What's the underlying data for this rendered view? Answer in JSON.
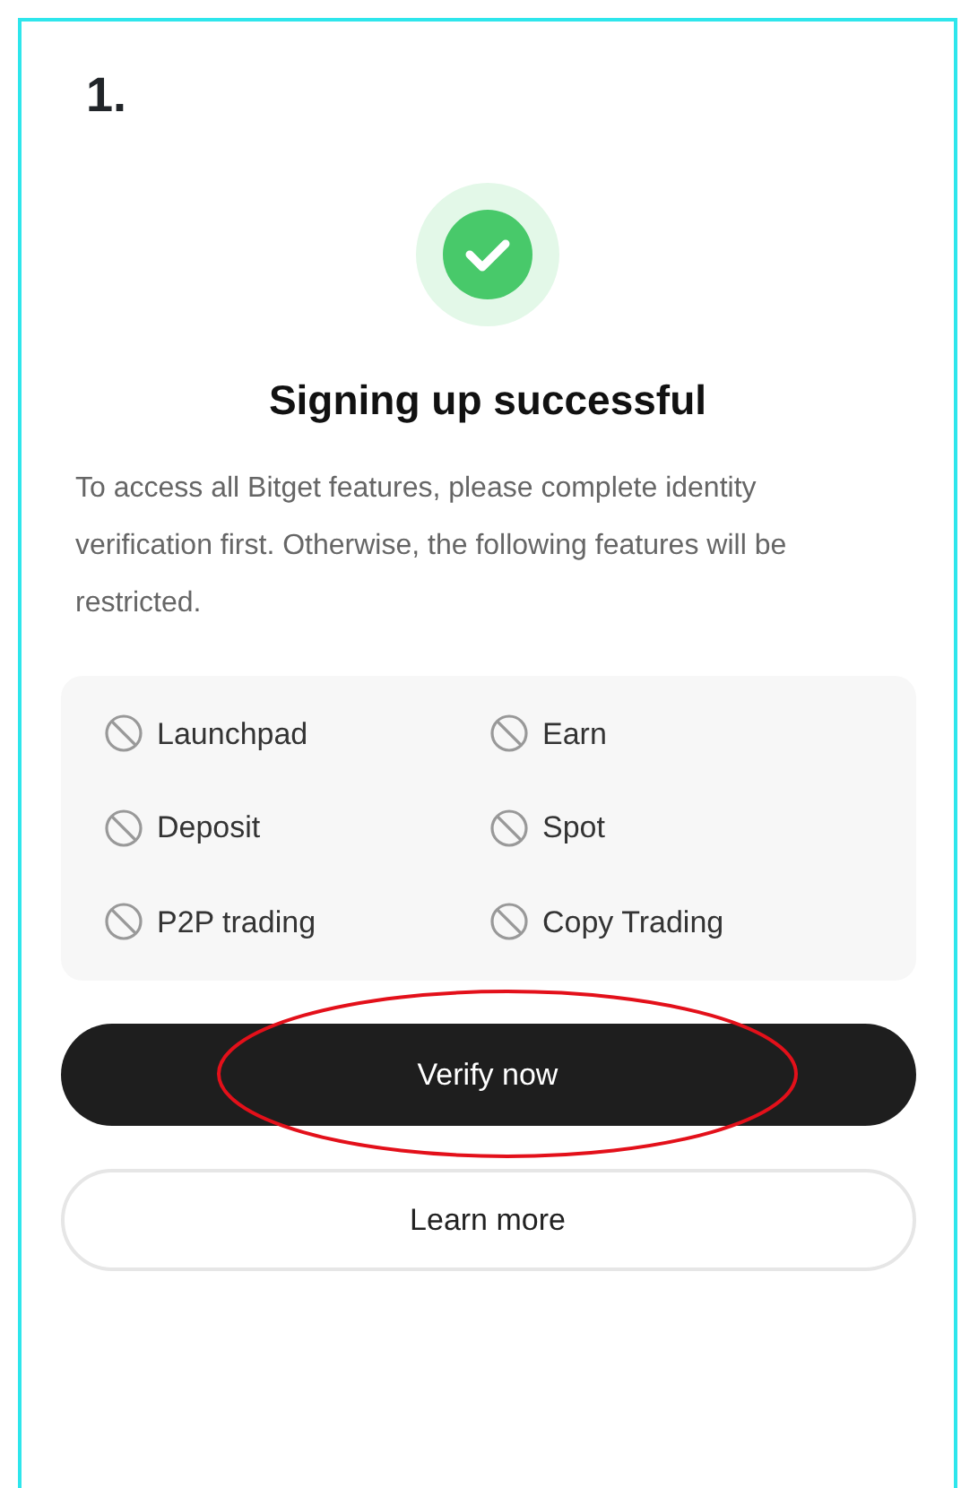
{
  "step_label": "1.",
  "status": {
    "kind": "success"
  },
  "title": "Signing up successful",
  "message": "To access all Bitget features, please complete identity verification first. Otherwise, the following features will be restricted.",
  "restricted_features": [
    {
      "label": "Launchpad"
    },
    {
      "label": "Earn"
    },
    {
      "label": "Deposit"
    },
    {
      "label": "Spot"
    },
    {
      "label": "P2P trading"
    },
    {
      "label": "Copy Trading"
    }
  ],
  "buttons": [
    {
      "label": "Verify now",
      "kind": "primary",
      "circled": true
    },
    {
      "label": "Learn more",
      "kind": "outline",
      "circled": false
    }
  ]
}
